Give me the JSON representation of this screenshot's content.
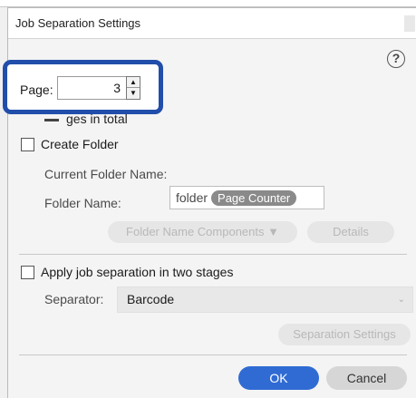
{
  "window": {
    "title": "Job Separation Settings"
  },
  "page_spinner": {
    "label": "Page:",
    "value": "3",
    "up_icon": "triangle-up-icon",
    "down_icon": "triangle-down-icon"
  },
  "hidden_option": {
    "visible_text": "ges in total"
  },
  "create_folder": {
    "label": "Create Folder",
    "checked": false,
    "current_folder_name_label": "Current Folder Name:",
    "folder_name_label": "Folder Name:",
    "folder_name_prefix": "folder",
    "folder_name_chip": "Page Counter",
    "components_button": "Folder Name Components ▼",
    "details_button": "Details"
  },
  "two_stages": {
    "label": "Apply job separation in two stages",
    "checked": false,
    "separator_label": "Separator:",
    "separator_value": "Barcode",
    "separation_settings_button": "Separation Settings"
  },
  "footer": {
    "ok": "OK",
    "cancel": "Cancel"
  },
  "colors": {
    "primary": "#2f6bd3",
    "highlight_border": "#214eaa",
    "disabled_text": "#b8b8b8"
  }
}
